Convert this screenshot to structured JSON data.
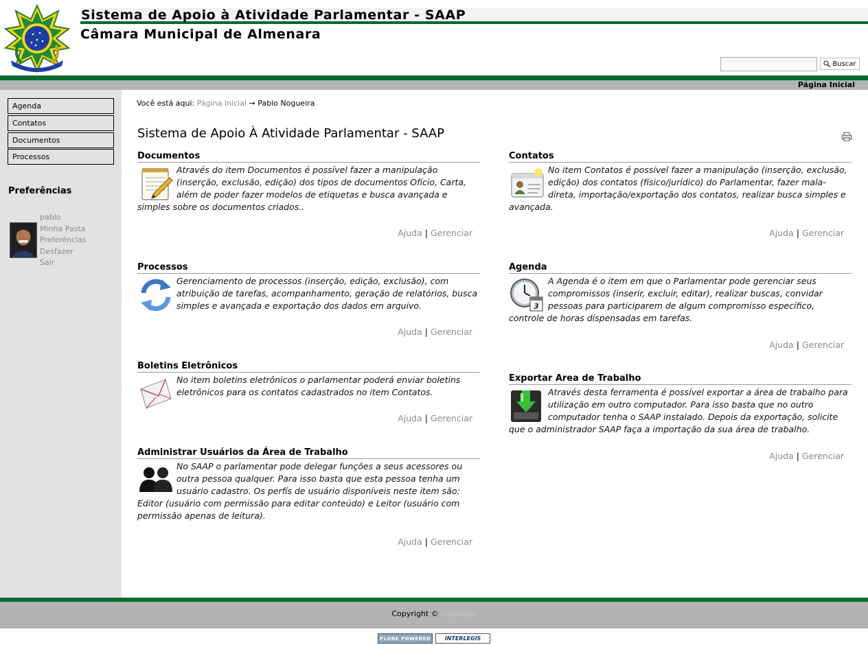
{
  "header": {
    "site_title": "Sistema de Apoio à Atividade Parlamentar - SAAP",
    "site_subtitle": "Câmara Municipal de Almenara",
    "search_button_label": "Buscar",
    "search_value": "",
    "home_link": "Página Inicial",
    "logo_icon": "brasao-coat-of-arms-icon"
  },
  "colors": {
    "accent_green": "#006b2d",
    "bar_grey": "#b3b3b3",
    "sidebar_grey": "#e2e2e2",
    "link_grey": "#8a8a8a"
  },
  "nav": {
    "items": [
      {
        "label": "Agenda"
      },
      {
        "label": "Contatos"
      },
      {
        "label": "Documentos"
      },
      {
        "label": "Processos"
      }
    ]
  },
  "preferences": {
    "heading": "Preferências",
    "username": "pablo",
    "links": [
      "Minha Pasta",
      "Preferências",
      "Desfazer",
      "Sair"
    ]
  },
  "breadcrumb": {
    "prefix": "Você está aqui:",
    "home": "Página Inicial",
    "arrow": "→",
    "current": "Pablo Nogueira"
  },
  "page": {
    "title": "Sistema de Apoio À Atividade Parlamentar - SAAP"
  },
  "sections": [
    {
      "title": "Documentos",
      "icon": "notepad-pencil-icon",
      "text": "Através do item Documentos é possível fazer a manipulação (inserção, exclusão, edição) dos tipos de documentos Ofício, Carta, além de poder fazer modelos de etiquetas e busca avançada e simples sobre os documentos criados..",
      "help": "Ajuda",
      "manage": "Gerenciar"
    },
    {
      "title": "Contatos",
      "icon": "contact-card-icon",
      "text": "No item Contatos é possível fazer a manipulação (inserção, exclusão, edição) dos contatos (físico/jurídico) do Parlamentar, fazer mala-direta, importação/exportação dos contatos, realizar busca simples e avançada.",
      "help": "Ajuda",
      "manage": "Gerenciar"
    },
    {
      "title": "Processos",
      "icon": "refresh-arrows-icon",
      "text": "Gerenciamento de processos (inserção, edição, exclusão), com atribuição de tarefas, acompanhamento, geração de relatórios, busca simples e avançada e exportação dos dados em arquivo.",
      "help": "Ajuda",
      "manage": "Gerenciar"
    },
    {
      "title": "Agenda",
      "icon": "clock-calendar-icon",
      "text": "A Agenda é o item em que o Parlamentar pode gerenciar seus compromissos (inserir, excluir, editar), realizar buscas, convidar pessoas para participarem de algum compromisso específico, controle de horas dispensadas em tarefas.",
      "help": "Ajuda",
      "manage": "Gerenciar"
    },
    {
      "title": "Boletins Eletrônicos",
      "icon": "envelope-icon",
      "text": "No item boletins eletrônicos o parlamentar poderá enviar boletins eletrônicos para os contatos cadastrados no item Contatos.",
      "help": "Ajuda",
      "manage": "Gerenciar"
    },
    {
      "title": "Exportar Area de Trabalho",
      "icon": "export-download-icon",
      "text": "Através desta ferramenta é possível exportar a área de trabalho para utilização em outro computador. Para isso basta que no outro computador tenha o SAAP instalado. Depois da exportação, solicite que o administrador SAAP faça a importação da sua área de trabalho.",
      "help": "Ajuda",
      "manage": "Gerenciar"
    },
    {
      "title": "Administrar Usuários da Área de Trabalho",
      "icon": "users-group-icon",
      "text": "No SAAP o parlamentar pode delegar funções a seus acessores ou outra pessoa qualquer. Para isso basta que esta pessoa tenha um usuário cadastro. Os perfís de usuário disponíveis neste item são: Editor (usuário com permissão para editar conteúdo) e Leitor (usuário com permissão apenas de leitura).",
      "help": "Ajuda",
      "manage": "Gerenciar"
    }
  ],
  "footer": {
    "copyright": "Copyright ©",
    "org": "Interlegis",
    "badge_plone": "PLONE POWERED",
    "badge_interlegis": "INTERLEGIS"
  }
}
